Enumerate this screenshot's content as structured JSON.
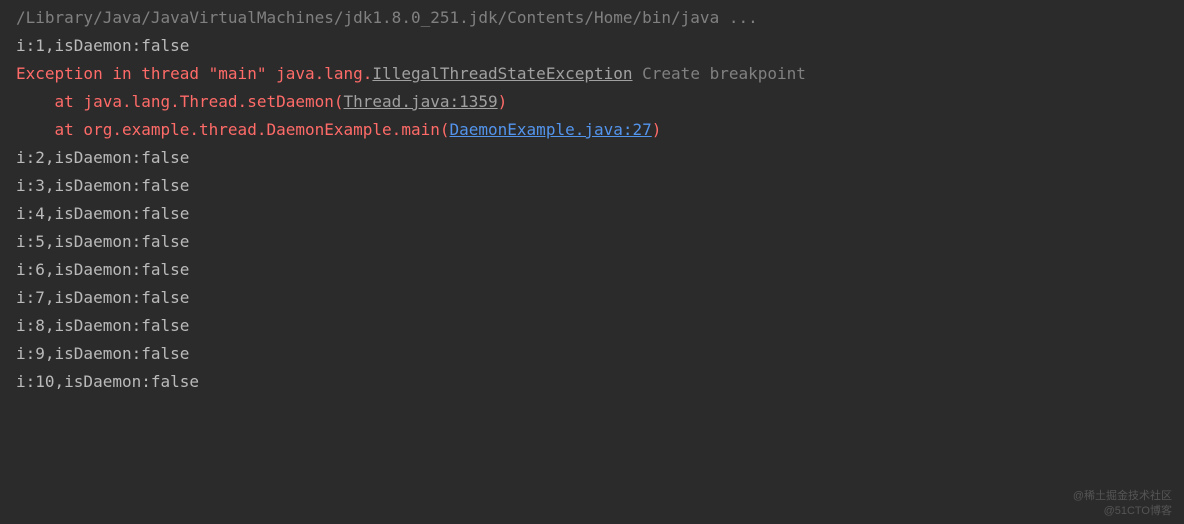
{
  "console": {
    "command": "/Library/Java/JavaVirtualMachines/jdk1.8.0_251.jdk/Contents/Home/bin/java ...",
    "output_before": "i:1,isDaemon:false",
    "exception": {
      "prefix": "Exception in thread \"main\" java.lang.",
      "class_link": "IllegalThreadStateException",
      "breakpoint_label": " Create breakpoint",
      "stack": [
        {
          "indent": "    ",
          "at_prefix": "at java.lang.Thread.setDaemon(",
          "link": "Thread.java:1359",
          "suffix": ")",
          "link_class": "gray"
        },
        {
          "indent": "    ",
          "at_prefix": "at org.example.thread.DaemonExample.main(",
          "link": "DaemonExample.java:27",
          "suffix": ")",
          "link_class": "blue"
        }
      ]
    },
    "output_after": [
      "i:2,isDaemon:false",
      "i:3,isDaemon:false",
      "i:4,isDaemon:false",
      "i:5,isDaemon:false",
      "i:6,isDaemon:false",
      "i:7,isDaemon:false",
      "i:8,isDaemon:false",
      "i:9,isDaemon:false",
      "i:10,isDaemon:false"
    ]
  },
  "watermark": {
    "line1": "@稀土掘金技术社区",
    "line2": "@51CTO博客"
  }
}
